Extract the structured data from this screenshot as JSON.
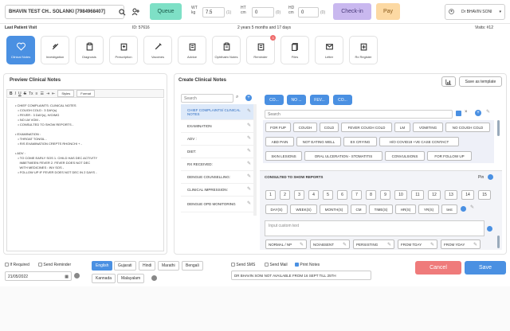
{
  "header": {
    "patient_name": "BHAVIN TEST CH.. SOLANKI [7984968407]",
    "queue_label": "Queue",
    "vitals": [
      {
        "label_top": "WT",
        "label_bottom": "kg",
        "value": "7.5",
        "unit": "(1)"
      },
      {
        "label_top": "HT",
        "label_bottom": "cm",
        "value": "0",
        "unit": "(0)"
      },
      {
        "label_top": "HD",
        "label_bottom": "cm",
        "value": "0",
        "unit": "(0)"
      }
    ],
    "checkin_label": "Check-in",
    "pay_label": "Pay",
    "doctor": "Dr BHAVIN SONI",
    "colors": {
      "queue": "#7ee0c6",
      "checkin": "#c9b8ef",
      "pay": "#fcd9a3",
      "accent": "#4a90e2"
    }
  },
  "info": {
    "last_visit": "Last Patient Visit",
    "id": "ID: 57616",
    "age": "2 years 5 months and 17 days",
    "visits": "Visits: #12"
  },
  "toolbar_icons": [
    {
      "label": "Clinical Notes",
      "icon": "heart-icon"
    },
    {
      "label": "Investigation",
      "icon": "syringe-icon"
    },
    {
      "label": "Diagnosis",
      "icon": "clipboard-icon"
    },
    {
      "label": "Prescription",
      "icon": "pill-icon"
    },
    {
      "label": "Vaccines",
      "icon": "vaccine-icon"
    },
    {
      "label": "Advice",
      "icon": "advice-icon"
    },
    {
      "label": "Ophthalm Notes",
      "icon": "notes-icon"
    },
    {
      "label": "Reminder",
      "icon": "bell-icon",
      "badge": "3"
    },
    {
      "label": "Files",
      "icon": "files-icon"
    },
    {
      "label": "Letter",
      "icon": "letter-icon"
    },
    {
      "label": "Rx Register",
      "icon": "register-icon"
    }
  ],
  "preview": {
    "title": "Preview Clinical Notes",
    "styles_label": "Styles",
    "format_label": "Format",
    "lines": [
      "• CHIEF COMPLAINTS: CLINICAL NOTES",
      "   • COUGH COLD : 3 DAY(s)",
      "   • FEVER : 3 DAY(s), H/O/MG",
      "   • NO LM VOM -",
      "   • CONSULTED TO SHOW REPORTS -",
      "",
      "• EXAMINATION :",
      "   • THROAT TONSIL -",
      "   • R/S EXAMINATION CREPTS RHONCHI + -",
      "",
      "• ADV :",
      "   • TO COME EARLY SOS 1. CHILD HAS DEC ACTIVITY",
      "     INBETWEEN FEVER 2. FEVER DOES NOT DEC",
      "     WITH MEDICINES : INV SOS -",
      "   • FOLLOW UP IF FEVER DOES NOT DEC IN 2 DAYS -"
    ]
  },
  "create": {
    "title": "Create Clinical Notes",
    "save_template": "Save as template",
    "search_placeholder": "Search",
    "categories": [
      "CHIEF COMPLAINTS/ CLINICAL NOTES",
      "EXAMINATION",
      "ADV :",
      "DIET:",
      "RX RECEIVED:",
      "DENGUE COUNSELLING:",
      "CLINICAL IMPRESSION:",
      "DENGUE OPD MONITORING"
    ],
    "selected_chips": [
      "CO...",
      "NO ...",
      "FEV...",
      "CO..."
    ],
    "suggest_search": "Search",
    "suggestions_row1": [
      "FOR FUP",
      "COUGH",
      "COLD",
      "FEVER COUGH COLD",
      "LM",
      "VOMITING",
      "NO COUGH COLD"
    ],
    "suggestions_row2": [
      "ABD PAIN",
      "NOT EATING WELL",
      "EX CRYING",
      "H/O COVID19 +VE CASE CONTACT"
    ],
    "suggestions_row3": [
      "SKIN LESIONS",
      "ORAL ULCERATION - STOMATITIS",
      "CONVULSIONS",
      "FOR FOLLOW UP"
    ],
    "consulted_title": "CONSULTED TO SHOW REPORTS",
    "pin_label": "Pin",
    "numbers": [
      "1",
      "2",
      "3",
      "4",
      "5",
      "6",
      "7",
      "8",
      "9",
      "10",
      "11",
      "12",
      "13",
      "14",
      "15"
    ],
    "units": [
      "DAY(S)",
      "WEEK(S)",
      "MONTH(S)",
      "CM",
      "TIME(S)",
      "HR(S)",
      "YR(S)",
      "test"
    ],
    "custom_placeholder": "Input custom text",
    "options": [
      "NORMAL / NP",
      "NO/ABSENT",
      "PERSISTING",
      "FROM TDAY",
      "FROM YDAY"
    ]
  },
  "footer": {
    "if_required": "If Required",
    "send_reminder": "Send Reminder",
    "date": "21/05/2022",
    "languages": [
      "English",
      "Gujarati",
      "Hindi",
      "Marathi",
      "Bengali",
      "Kannada",
      "Malayalam"
    ],
    "send_sms": "Send SMS",
    "send_mail": "Send Mail",
    "print_notes": "Print Notes",
    "note": "DR BHAVIN SONI NOT AVAILABLE FROM 16 SEPT TILL 25TH",
    "cancel": "Cancel",
    "save": "Save"
  }
}
